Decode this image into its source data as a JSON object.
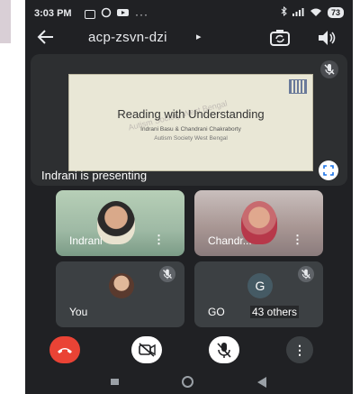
{
  "status_bar": {
    "time": "3:03 PM",
    "battery": "73"
  },
  "header": {
    "title": "acp-zsvn-dzi",
    "caret": "▸"
  },
  "presentation": {
    "label": "Indrani is presenting",
    "slide_title": "Reading with Understanding",
    "slide_authors": "Indrani Basu  &  Chandrani Chakraborty",
    "slide_org": "Autism Society West Bengal",
    "watermark": "Autism Society West Bengal"
  },
  "participants": [
    {
      "name": "Indrani",
      "more": "⋮"
    },
    {
      "name": "Chandr...",
      "more": "⋮"
    },
    {
      "name": "You"
    },
    {
      "name": "GO",
      "initial": "G",
      "others": "43 others"
    }
  ],
  "controls": {
    "more_label": "⋮"
  },
  "colors": {
    "background": "#202124",
    "tile": "#3c4043",
    "end_call": "#ea4335",
    "icon": "#e8eaed"
  }
}
